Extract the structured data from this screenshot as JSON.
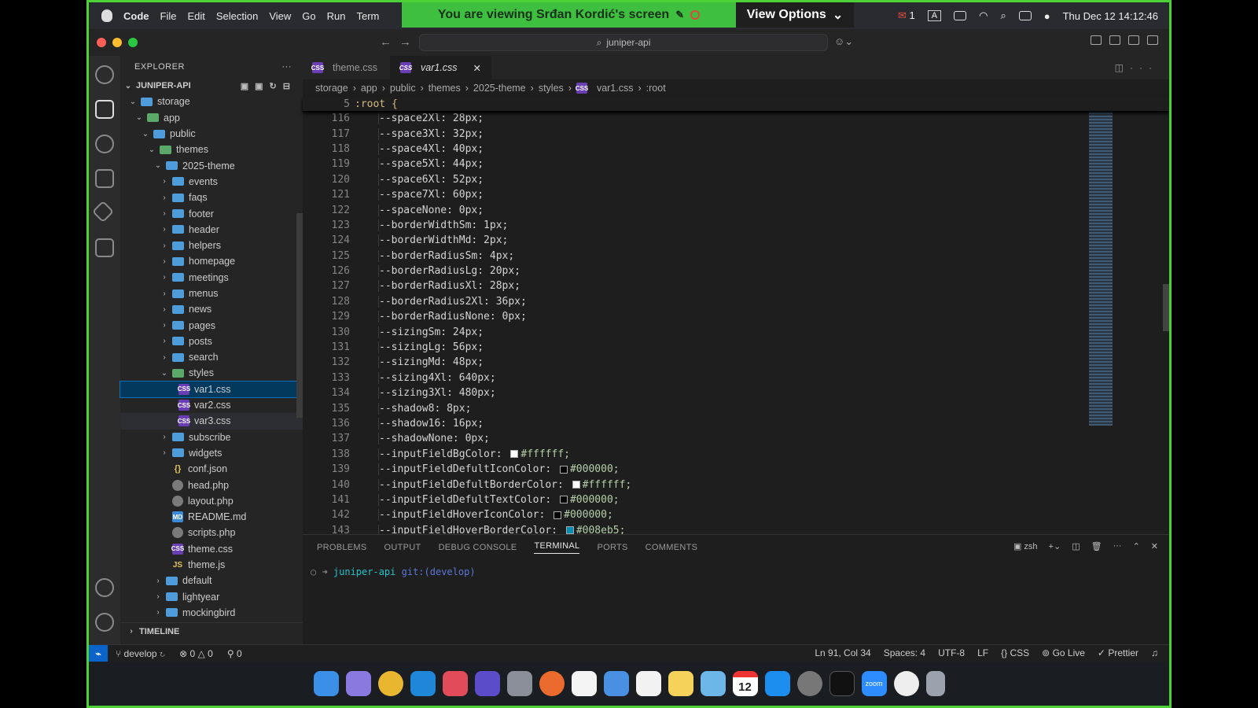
{
  "menubar": {
    "app": "Code",
    "items": [
      "File",
      "Edit",
      "Selection",
      "View",
      "Go",
      "Run",
      "Term"
    ],
    "right": [
      "1",
      "A",
      "Thu Dec 12  14:12:46"
    ]
  },
  "banner": {
    "text": "You are viewing  Srđan Kordić's screen",
    "view_options": "View Options"
  },
  "titlebar": {
    "search": "juniper-api"
  },
  "explorer": {
    "title": "EXPLORER",
    "project": "JUNIPER-API",
    "tree": [
      {
        "label": "storage",
        "depth": 1,
        "type": "folder",
        "open": true
      },
      {
        "label": "app",
        "depth": 2,
        "type": "gfolder",
        "open": true
      },
      {
        "label": "public",
        "depth": 3,
        "type": "folder",
        "open": true
      },
      {
        "label": "themes",
        "depth": 4,
        "type": "gfolder",
        "open": true
      },
      {
        "label": "2025-theme",
        "depth": 5,
        "type": "folder",
        "open": true
      },
      {
        "label": "events",
        "depth": 6,
        "type": "folder"
      },
      {
        "label": "faqs",
        "depth": 6,
        "type": "folder"
      },
      {
        "label": "footer",
        "depth": 6,
        "type": "folder"
      },
      {
        "label": "header",
        "depth": 6,
        "type": "folder"
      },
      {
        "label": "helpers",
        "depth": 6,
        "type": "folder"
      },
      {
        "label": "homepage",
        "depth": 6,
        "type": "folder"
      },
      {
        "label": "meetings",
        "depth": 6,
        "type": "folder"
      },
      {
        "label": "menus",
        "depth": 6,
        "type": "folder"
      },
      {
        "label": "news",
        "depth": 6,
        "type": "folder"
      },
      {
        "label": "pages",
        "depth": 6,
        "type": "folder"
      },
      {
        "label": "posts",
        "depth": 6,
        "type": "folder"
      },
      {
        "label": "search",
        "depth": 6,
        "type": "folder"
      },
      {
        "label": "styles",
        "depth": 6,
        "type": "gfolder",
        "open": true
      },
      {
        "label": "var1.css",
        "depth": 7,
        "type": "css",
        "state": "selected"
      },
      {
        "label": "var2.css",
        "depth": 7,
        "type": "css"
      },
      {
        "label": "var3.css",
        "depth": 7,
        "type": "css",
        "state": "hover"
      },
      {
        "label": "subscribe",
        "depth": 6,
        "type": "folder"
      },
      {
        "label": "widgets",
        "depth": 6,
        "type": "folder"
      },
      {
        "label": "conf.json",
        "depth": 6,
        "type": "json"
      },
      {
        "label": "head.php",
        "depth": 6,
        "type": "php"
      },
      {
        "label": "layout.php",
        "depth": 6,
        "type": "php"
      },
      {
        "label": "README.md",
        "depth": 6,
        "type": "md"
      },
      {
        "label": "scripts.php",
        "depth": 6,
        "type": "php"
      },
      {
        "label": "theme.css",
        "depth": 6,
        "type": "css"
      },
      {
        "label": "theme.js",
        "depth": 6,
        "type": "js"
      },
      {
        "label": "default",
        "depth": 5,
        "type": "folder"
      },
      {
        "label": "lightyear",
        "depth": 5,
        "type": "folder"
      },
      {
        "label": "mockingbird",
        "depth": 5,
        "type": "folder"
      }
    ],
    "timeline": "TIMELINE"
  },
  "tabs": [
    {
      "label": "theme.css",
      "active": false
    },
    {
      "label": "var1.css",
      "active": true
    }
  ],
  "breadcrumb": [
    "storage",
    "app",
    "public",
    "themes",
    "2025-theme",
    "styles",
    "var1.css",
    ":root"
  ],
  "sticky": {
    "line": "5",
    "text": ":root {"
  },
  "code": [
    {
      "ln": "116",
      "text": "--space2Xl: 28px;"
    },
    {
      "ln": "117",
      "text": "--space3Xl: 32px;"
    },
    {
      "ln": "118",
      "text": "--space4Xl: 40px;"
    },
    {
      "ln": "119",
      "text": "--space5Xl: 44px;"
    },
    {
      "ln": "120",
      "text": "--space6Xl: 52px;"
    },
    {
      "ln": "121",
      "text": "--space7Xl: 60px;"
    },
    {
      "ln": "122",
      "text": "--spaceNone: 0px;"
    },
    {
      "ln": "123",
      "text": "--borderWidthSm: 1px;"
    },
    {
      "ln": "124",
      "text": "--borderWidthMd: 2px;"
    },
    {
      "ln": "125",
      "text": "--borderRadiusSm: 4px;"
    },
    {
      "ln": "126",
      "text": "--borderRadiusLg: 20px;"
    },
    {
      "ln": "127",
      "text": "--borderRadiusXl: 28px;"
    },
    {
      "ln": "128",
      "text": "--borderRadius2Xl: 36px;"
    },
    {
      "ln": "129",
      "text": "--borderRadiusNone: 0px;"
    },
    {
      "ln": "130",
      "text": "--sizingSm: 24px;"
    },
    {
      "ln": "131",
      "text": "--sizingLg: 56px;"
    },
    {
      "ln": "132",
      "text": "--sizingMd: 48px;"
    },
    {
      "ln": "133",
      "text": "--sizing4Xl: 640px;"
    },
    {
      "ln": "134",
      "text": "--sizing3Xl: 480px;"
    },
    {
      "ln": "135",
      "text": "--shadow8: 8px;"
    },
    {
      "ln": "136",
      "text": "--shadow16: 16px;"
    },
    {
      "ln": "137",
      "text": "--shadowNone: 0px;"
    },
    {
      "ln": "138",
      "text": "--inputFieldBgColor: ",
      "swatch": "#ffffff",
      "value": "#ffffff;"
    },
    {
      "ln": "139",
      "text": "--inputFieldDefultIconColor: ",
      "swatch": "#000000",
      "value": "#000000;"
    },
    {
      "ln": "140",
      "text": "--inputFieldDefultBorderColor: ",
      "swatch": "#ffffff",
      "value": "#ffffff;"
    },
    {
      "ln": "141",
      "text": "--inputFieldDefultTextColor: ",
      "swatch": "#000000",
      "value": "#000000;"
    },
    {
      "ln": "142",
      "text": "--inputFieldHoverIconColor: ",
      "swatch": "#000000",
      "value": "#000000;"
    },
    {
      "ln": "143",
      "text": "--inputFieldHoverBorderColor: ",
      "swatch": "#008eb5",
      "value": "#008eb5;"
    }
  ],
  "panel": {
    "tabs": [
      "PROBLEMS",
      "OUTPUT",
      "DEBUG CONSOLE",
      "TERMINAL",
      "PORTS",
      "COMMENTS"
    ],
    "active": "TERMINAL",
    "shell": "zsh",
    "prompt_dir": "juniper-api",
    "prompt_git": "git:(develop)"
  },
  "statusbar": {
    "branch": "develop",
    "errors": "0",
    "warnings": "0",
    "ports": "0",
    "position": "Ln 91, Col 34",
    "spaces": "Spaces: 4",
    "encoding": "UTF-8",
    "eol": "LF",
    "language": "CSS",
    "golive": "Go Live",
    "prettier": "Prettier"
  },
  "dock": {
    "calendar_day": "12",
    "zoom": "zoom"
  }
}
